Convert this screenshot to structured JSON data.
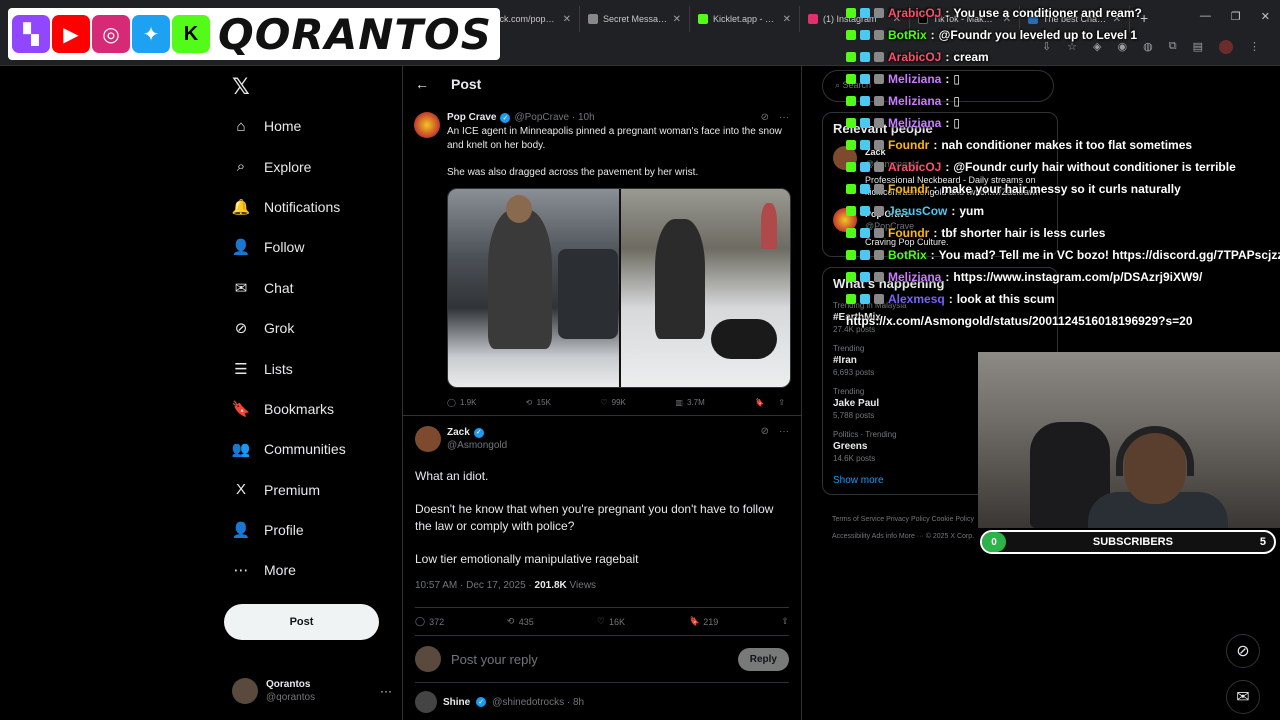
{
  "browser": {
    "tabs": [
      {
        "label": "kick.com/popout",
        "color": "#53fc18"
      },
      {
        "label": "Secret Message",
        "color": "#888888"
      },
      {
        "label": "Kicklet.app - Kick",
        "color": "#53fc18"
      },
      {
        "label": "(1) Instagram",
        "color": "#e1306c"
      },
      {
        "label": "TikTok - Make Yo",
        "color": "#000000"
      },
      {
        "label": "The best ChatBot",
        "color": "#2b6cb0"
      }
    ]
  },
  "logo": {
    "text": "QORANTOS"
  },
  "sidebar": {
    "items": [
      {
        "label": "Home",
        "icon": "⌂"
      },
      {
        "label": "Explore",
        "icon": "⌕"
      },
      {
        "label": "Notifications",
        "icon": "🔔"
      },
      {
        "label": "Follow",
        "icon": "👤"
      },
      {
        "label": "Chat",
        "icon": "✉"
      },
      {
        "label": "Grok",
        "icon": "⊘"
      },
      {
        "label": "Lists",
        "icon": "☰"
      },
      {
        "label": "Bookmarks",
        "icon": "🔖"
      },
      {
        "label": "Communities",
        "icon": "👥"
      },
      {
        "label": "Premium",
        "icon": "X"
      },
      {
        "label": "Profile",
        "icon": "👤"
      },
      {
        "label": "More",
        "icon": "⋯"
      }
    ],
    "post_label": "Post",
    "account": {
      "name": "Qorantos",
      "handle": "@qorantos"
    }
  },
  "main": {
    "title": "Post",
    "tweet": {
      "name": "Pop Crave",
      "handle": "@PopCrave · 10h",
      "text1": "An ICE agent in Minneapolis pinned a pregnant woman's face into the snow and knelt on her body.",
      "text2": "She was also dragged across the pavement by her wrist.",
      "stats": {
        "replies": "1.9K",
        "reposts": "15K",
        "likes": "99K",
        "views": "3.7M"
      }
    },
    "reply": {
      "name": "Zack",
      "handle": "@Asmongold",
      "p1": "What an idiot.",
      "p2": "Doesn't he know that when you're pregnant you don't have to follow the law or comply with police?",
      "p3": "Low tier emotionally manipulative ragebait",
      "time": "10:57 AM · Dec 17, 2025 · ",
      "views": "201.8K",
      "views_label": " Views",
      "actions": {
        "replies": "372",
        "reposts": "435",
        "likes": "16K",
        "bookmarks": "219"
      }
    },
    "compose_placeholder": "Post your reply",
    "reply_button": "Reply",
    "next": {
      "name": "Shine",
      "handle": "@shinedotrocks · 8h"
    }
  },
  "right": {
    "search_placeholder": "Search",
    "relevant_title": "Relevant people",
    "rp_name": "Zack",
    "rp_handle": "@Asmongold",
    "rp_bio": "Professional Neckbeard - Daily streams on kick.com/asmongold and twitch.tv/Zackrawrr",
    "rp2_name": "Pop Crave",
    "rp2_handle": "@PopCrave",
    "rp2_bio": "Craving Pop Culture.",
    "happening_title": "What's happening",
    "trends": [
      {
        "cat": "Trending in Malaysia",
        "name": "#EarthMix",
        "count": "27.4K posts"
      },
      {
        "cat": "Trending",
        "name": "#Iran",
        "count": "6,693 posts"
      },
      {
        "cat": "Trending",
        "name": "Jake Paul",
        "count": "5,788 posts"
      },
      {
        "cat": "Politics · Trending",
        "name": "Greens",
        "count": "14.6K posts"
      }
    ],
    "show_more": "Show more",
    "footer1": "Terms of Service   Privacy Policy   Cookie Policy",
    "footer2": "Accessibility   Ads info   More ···   © 2025 X Corp."
  },
  "chat": [
    {
      "user": "ArabicOJ",
      "color": "#ff4d6d",
      "msg": "You use a conditioner and ream?"
    },
    {
      "user": "BotRix",
      "color": "#53fc18",
      "msg": "@Foundr you leveled up to Level 1"
    },
    {
      "user": "ArabicOJ",
      "color": "#ff4d6d",
      "msg": "cream"
    },
    {
      "user": "Meliziana",
      "color": "#c77dff",
      "msg": "▯"
    },
    {
      "user": "Meliziana",
      "color": "#c77dff",
      "msg": "▯"
    },
    {
      "user": "Meliziana",
      "color": "#c77dff",
      "msg": "▯"
    },
    {
      "user": "Foundr",
      "color": "#ffb703",
      "msg": "nah conditioner makes it too flat sometimes"
    },
    {
      "user": "ArabicOJ",
      "color": "#ff4d6d",
      "msg": "@Foundr curly hair without conditioner is terrible"
    },
    {
      "user": "Foundr",
      "color": "#ffb703",
      "msg": "make your hair messy so it curls naturally"
    },
    {
      "user": "JesusCow",
      "color": "#4cc9f0",
      "msg": "yum"
    },
    {
      "user": "Foundr",
      "color": "#ffb703",
      "msg": "tbf shorter hair is less curles"
    },
    {
      "user": "BotRix",
      "color": "#53fc18",
      "msg": "You mad? Tell me in VC bozo! https://discord.gg/7TPAPscjzz"
    },
    {
      "user": "Meliziana",
      "color": "#c77dff",
      "msg": "https://www.instagram.com/p/DSAzrj9iXW9/"
    },
    {
      "user": "Alexmesq",
      "color": "#7b61ff",
      "msg": "look at this scum"
    },
    {
      "user": "",
      "color": "#ffffff",
      "msg": "https://x.com/Asmongold/status/2001124516018196929?s=20"
    }
  ],
  "subscribers": {
    "label": "SUBSCRIBERS",
    "current": "0",
    "goal": "5"
  }
}
